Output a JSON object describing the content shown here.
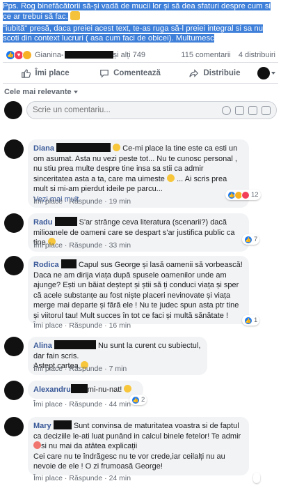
{
  "post": {
    "line1": "Pps. Rog binefăcătorii să-și vadă de mucii lor și să dea sfaturi despre cum si ce ar trebui să fac.",
    "line2": "\"iubită\" presă, daca preiei acest text, te-as ruga să-l preiei integral si sa nu scoti din context lucruri ( asa cum faci de obicei). Multumesc"
  },
  "reactions": {
    "names_start": "Gianina-",
    "names_end": "și alți 749",
    "comments_count": "115 comentarii",
    "shares_count": "4 distribuiri"
  },
  "actions": {
    "like": "Îmi place",
    "comment": "Comentează",
    "share": "Distribuie"
  },
  "filter": {
    "label": "Cele mai relevante"
  },
  "composer": {
    "placeholder": "Scrie un comentariu..."
  },
  "comments": [
    {
      "author": "Diana",
      "text": "Ce-mi place la tine este ca esti un om asumat. Asta nu vezi peste tot... Nu te cunosc personal , nu stiu prea multe despre tine insa sa stii ca admir sinceritatea asta a ta, care ma uimeste",
      "text_tail": "... Ai scris prea mult si mi-am pierdut ideile pe parcu...",
      "see_more": "Vezi mai mult",
      "like": "Îmi place",
      "reply": "Răspunde",
      "time": "19 min",
      "reactions_count": "12"
    },
    {
      "author": "Radu",
      "text": "S'ar strânge ceva literatura (scenarii?) dacă milioanele de oameni care se despart s'ar justifica public ca tine",
      "like": "Îmi place",
      "reply": "Răspunde",
      "time": "33 min",
      "reactions_count": "7"
    },
    {
      "author": "Rodica",
      "text": "Capul sus George și lasă oamenii să vorbească! Daca ne am dirija viața după spusele oamenilor unde am ajunge? Ești un băiat deștept și știi să ți conduci viața și sper că acele substanțe au fost niște placeri nevinovate și viața merge mai departe și fără ele ! Nu te judec spun asta ptr tine și viitorul tau! Mult succes în tot ce faci și multă sănătate !",
      "like": "Îmi place",
      "reply": "Răspunde",
      "time": "16 min",
      "reactions_count": "1"
    },
    {
      "author": "Alina",
      "text": "Nu sunt la curent cu subiectul, dar fain scris.",
      "text2": "Astept cartea",
      "like": "Îmi place",
      "reply": "Răspunde",
      "time": "7 min"
    },
    {
      "author": "Alexandru",
      "text": "mi-nu-nat!",
      "like": "Îmi place",
      "reply": "Răspunde",
      "time": "44 min",
      "reactions_count": "2"
    },
    {
      "author": "Mary",
      "text": "Sunt convinsa de maturitatea voastra si de faptul ca deciziile le-ati luat punând in calcul binele fetelor! Te admir",
      "text_b": "si nu mai da atâtea explicații",
      "text_c": "Cei care nu te îndrăgesc nu te vor crede,iar ceilalți nu au nevoie de ele ! O zi frumoasă George!",
      "like": "Îmi place",
      "reply": "Răspunde",
      "time": "24 min"
    }
  ],
  "colors": {
    "link": "#385898",
    "bubble": "#f2f3f5",
    "highlight": "#3e7fd9",
    "like_blue": "#1877f2"
  }
}
